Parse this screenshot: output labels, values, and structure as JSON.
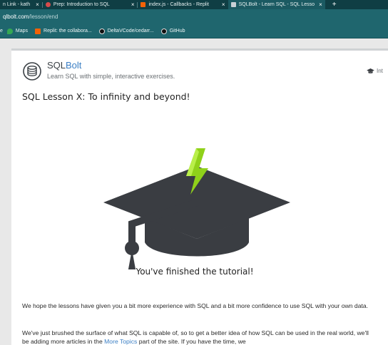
{
  "browser": {
    "tabs": [
      {
        "label": "n Link - kath",
        "icon_color": "#4a90d9",
        "active": false
      },
      {
        "label": "Prep: Introduction to SQL",
        "icon_color": "#d64b4b",
        "active": false
      },
      {
        "label": "index.js - Callbacks - Replit",
        "icon_color": "#f26207",
        "active": false
      },
      {
        "label": "SQLBolt - Learn SQL - SQL Lesso",
        "icon_color": "#c8d0d6",
        "active": true
      }
    ],
    "tab_close": "×",
    "new_tab": "+",
    "address": {
      "host": "qlbolt.com",
      "path": "/lesson/end"
    },
    "bookmarks": [
      {
        "label": "Maps",
        "icon_color": "#34a853"
      },
      {
        "label": "Replit: the collabora...",
        "icon_color": "#f26207"
      },
      {
        "label": "DeltaVCode/cedarr...",
        "icon_color": "#111111"
      },
      {
        "label": "GitHub",
        "icon_color": "#111111"
      }
    ],
    "bookmark_lead": "e"
  },
  "site": {
    "brand_sql": "SQL",
    "brand_bolt": "Bolt",
    "tagline": "Learn SQL with simple, interactive exercises.",
    "intro_link": "Int"
  },
  "lesson": {
    "title": "SQL Lesson X: To infinity and beyond!",
    "finished": "You've finished the tutorial!",
    "para1": "We hope the lessons have given you a bit more experience with SQL and a bit more confidence to use SQL with your own data.",
    "para2_before": "We've just brushed the surface of what SQL is capable of, so to get a better idea of how SQL can be used in the real world, we'll be adding more articles in the ",
    "para2_link": "More Topics",
    "para2_after": " part of the site. If you have the time, we"
  },
  "colors": {
    "tabstrip": "#0f3e44",
    "toolbar": "#1f666e",
    "accent": "#3b7fc4",
    "cap": "#3a3d42",
    "bolt": "#8fd11a"
  }
}
